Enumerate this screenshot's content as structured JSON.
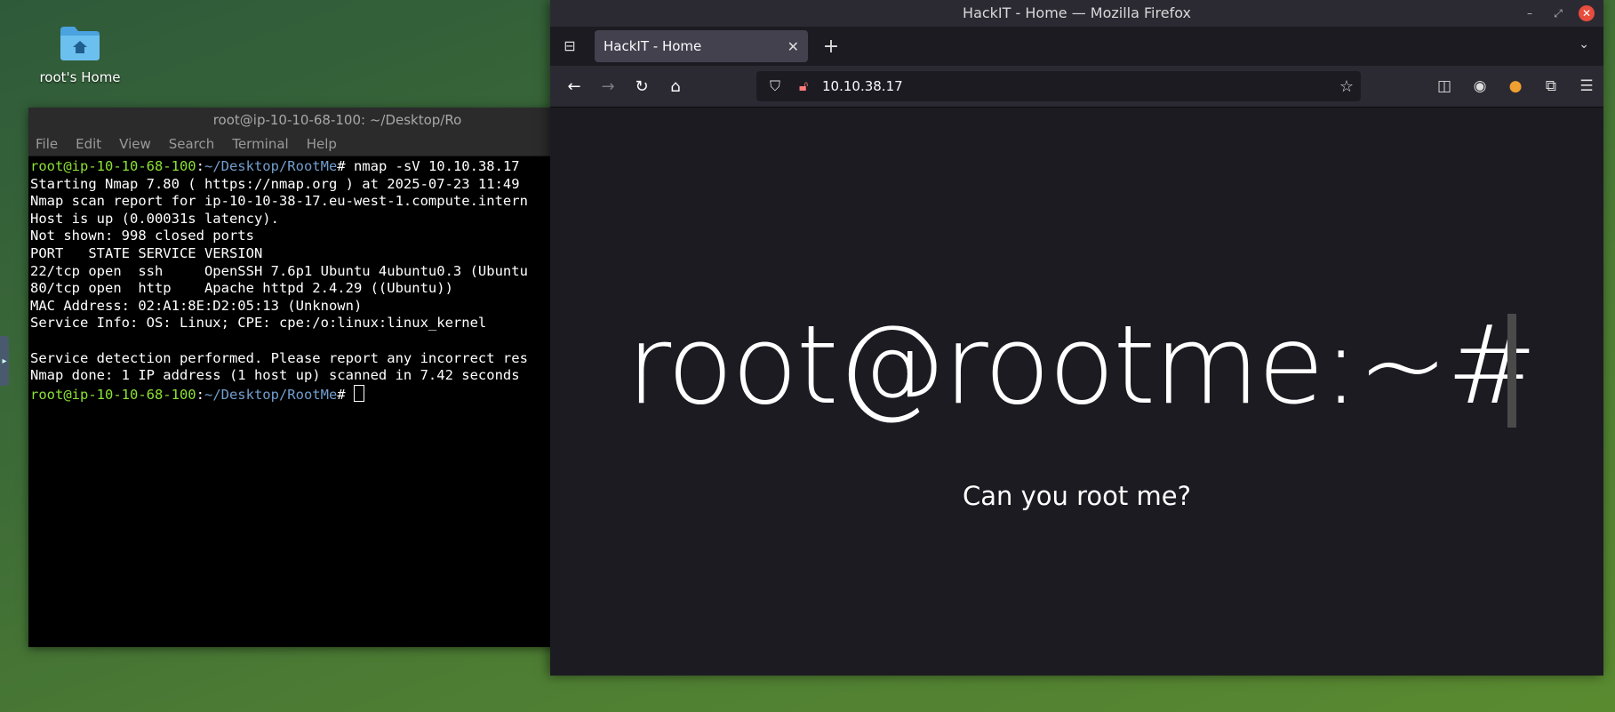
{
  "desktop": {
    "icon_label": "root's Home"
  },
  "terminal": {
    "title": "root@ip-10-10-68-100: ~/Desktop/Ro",
    "menu": [
      "File",
      "Edit",
      "View",
      "Search",
      "Terminal",
      "Help"
    ],
    "prompt_user": "root@ip-10-10-68-100",
    "prompt_path": "~/Desktop/RootMe",
    "command": "nmap -sV 10.10.38.17",
    "output": [
      "Starting Nmap 7.80 ( https://nmap.org ) at 2025-07-23 11:49",
      "Nmap scan report for ip-10-10-38-17.eu-west-1.compute.intern",
      "Host is up (0.00031s latency).",
      "Not shown: 998 closed ports",
      "PORT   STATE SERVICE VERSION",
      "22/tcp open  ssh     OpenSSH 7.6p1 Ubuntu 4ubuntu0.3 (Ubuntu",
      "80/tcp open  http    Apache httpd 2.4.29 ((Ubuntu))",
      "MAC Address: 02:A1:8E:D2:05:13 (Unknown)",
      "Service Info: OS: Linux; CPE: cpe:/o:linux:linux_kernel",
      "",
      "Service detection performed. Please report any incorrect res",
      "Nmap done: 1 IP address (1 host up) scanned in 7.42 seconds"
    ]
  },
  "firefox": {
    "window_title": "HackIT - Home — Mozilla Firefox",
    "tab_title": "HackIT - Home",
    "url": "10.10.38.17",
    "hero_text": "root@rootme:~#",
    "subtitle": "Can you root me?"
  }
}
